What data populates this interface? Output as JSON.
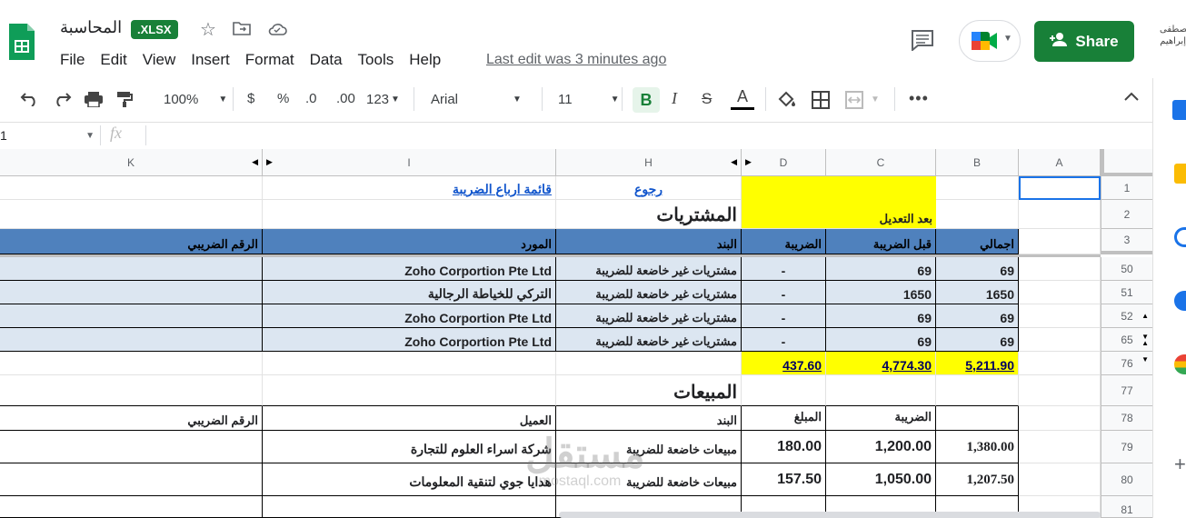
{
  "app": {
    "title": "المحاسبة",
    "badge": ".XLSX",
    "share_label": "Share",
    "last_edit": "Last edit was 3 minutes ago",
    "user_line1": "مصطفى",
    "user_line2": "إبراهيم"
  },
  "menu": [
    "File",
    "Edit",
    "View",
    "Insert",
    "Format",
    "Data",
    "Tools",
    "Help"
  ],
  "toolbar": {
    "zoom": "100%",
    "currency": "$",
    "percent": "%",
    "dec_dec": ".0",
    "inc_dec": ".00",
    "more_formats": "123",
    "font": "Arial",
    "font_size": "11",
    "bold": "B",
    "italic": "I",
    "strike": "S",
    "text_color": "A"
  },
  "formula_bar": {
    "name_box": "1",
    "fx": "fx",
    "value": ""
  },
  "columns": [
    "K",
    "I",
    "H",
    "D",
    "C",
    "B",
    "A"
  ],
  "rows": [
    "1",
    "2",
    "3",
    "50",
    "51",
    "52",
    "65",
    "76",
    "77",
    "78",
    "79",
    "80",
    "81"
  ],
  "sheet": {
    "tax_quarters_link": "قائمة ارباع الضريبة",
    "back_link": "رجوع",
    "purchases_title": "المشتريات",
    "after_edit": "بعد التعديل",
    "purchase_headers": {
      "tax_number": "الرقم الضريبي",
      "supplier": "المورد",
      "item": "البند",
      "tax": "الضريبة",
      "before_tax": "قبل الضريبة",
      "total": "اجمالي"
    },
    "purchases": [
      {
        "supplier": "Zoho Corportion Pte Ltd",
        "item": "مشتريات غير خاضعة للضريبة",
        "tax": "-",
        "before_tax": "69",
        "total": "69"
      },
      {
        "supplier": "التركي للخياطة الرجالية",
        "item": "مشتريات غير خاضعة للضريبة",
        "tax": "-",
        "before_tax": "1650",
        "total": "1650"
      },
      {
        "supplier": "Zoho Corportion Pte Ltd",
        "item": "مشتريات غير خاضعة للضريبة",
        "tax": "-",
        "before_tax": "69",
        "total": "69"
      },
      {
        "supplier": "Zoho Corportion Pte Ltd",
        "item": "مشتريات غير خاضعة للضريبة",
        "tax": "-",
        "before_tax": "69",
        "total": "69"
      }
    ],
    "purchase_totals": {
      "tax": "437.60",
      "before_tax": "4,774.30",
      "total": "5,211.90"
    },
    "sales_title": "المبيعات",
    "sales_headers": {
      "tax_number": "الرقم الضريبي",
      "client": "العميل",
      "item": "البند",
      "amount": "المبلغ",
      "tax": "الضريبة"
    },
    "sales": [
      {
        "client": "شركة اسراء العلوم للتجارة",
        "item": "مبيعات خاضعة للضريبة",
        "amount": "180.00",
        "tax": "1,200.00",
        "total": "1,380.00"
      },
      {
        "client": "هدايا جوي لتنقية المعلومات",
        "item": "مبيعات خاضعة للضريبة",
        "amount": "157.50",
        "tax": "1,050.00",
        "total": "1,207.50"
      }
    ],
    "watermark": "مستقل",
    "watermark_sub": "mostaql.com"
  }
}
